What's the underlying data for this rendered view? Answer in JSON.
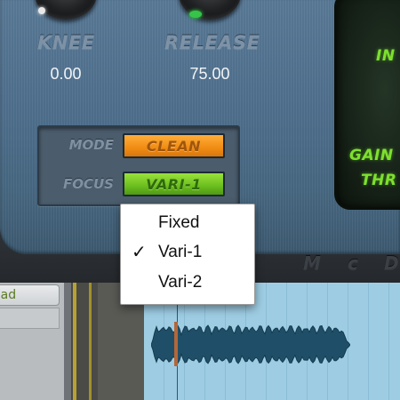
{
  "plugin": {
    "knee": {
      "label": "KNEE",
      "value": "0.00"
    },
    "release": {
      "label": "RELEASE",
      "value": "75.00"
    },
    "mode": {
      "label": "MODE",
      "selected": "CLEAN"
    },
    "focus": {
      "label": "FOCUS",
      "selected": "VARI-1"
    },
    "meter": {
      "in_label": "IN",
      "gain_label": "GAIN",
      "thr_label": "THR"
    },
    "brand_letters": [
      "M",
      "c",
      "D"
    ],
    "colors": {
      "mode_accent": "#f08c14",
      "focus_accent": "#6bbe1e",
      "meter_text": "#7ee02e"
    }
  },
  "focus_menu": {
    "items": [
      {
        "label": "Fixed",
        "checked": false
      },
      {
        "label": "Vari-1",
        "checked": true
      },
      {
        "label": "Vari-2",
        "checked": false
      }
    ],
    "check_glyph": "✓"
  },
  "track": {
    "name": "ead"
  }
}
